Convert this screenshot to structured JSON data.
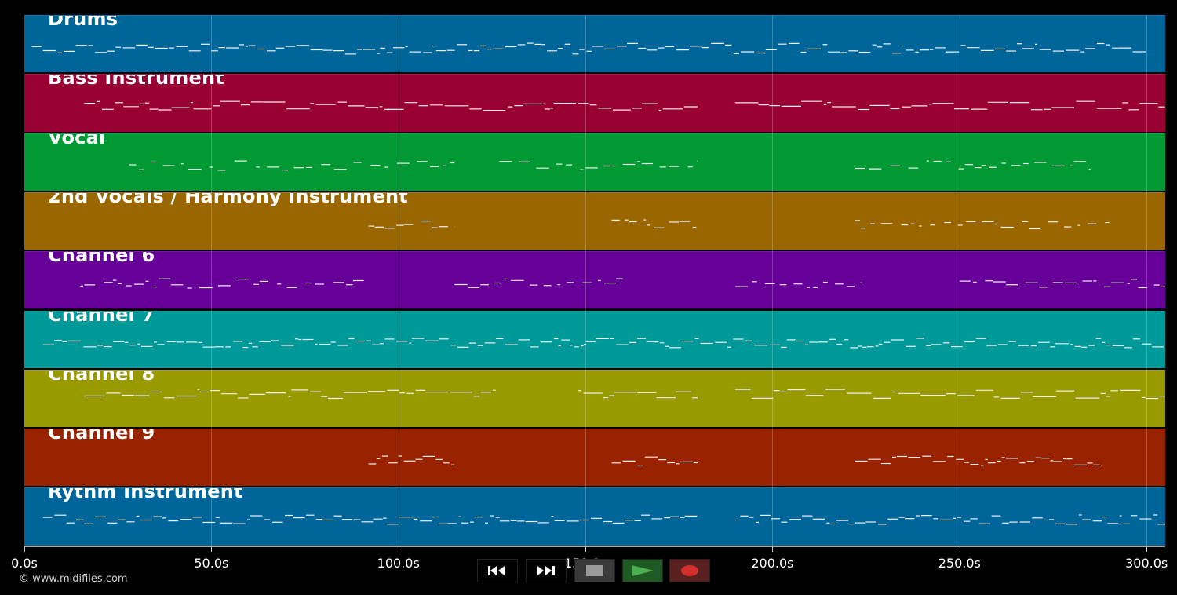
{
  "tracks": [
    {
      "name": "Drums",
      "color": "#006699"
    },
    {
      "name": "Bass Instrument",
      "color": "#990033"
    },
    {
      "name": "Vocal",
      "color": "#009933"
    },
    {
      "name": "2nd Vocals / Harmony Instrument",
      "color": "#996600"
    },
    {
      "name": "Channel 6",
      "color": "#660099"
    },
    {
      "name": "Channel 7",
      "color": "#009999"
    },
    {
      "name": "Channel 8",
      "color": "#999900"
    },
    {
      "name": "Channel 9",
      "color": "#992200"
    },
    {
      "name": "Rythm Instrument",
      "color": "#006699"
    }
  ],
  "timeline": {
    "ticks": [
      "0.0s",
      "50.0s",
      "100.0s",
      "150.0s",
      "200.0s",
      "250.0s",
      "300.0s"
    ]
  },
  "copyright": "© www.midifiles.com",
  "transport": {
    "buttons": [
      {
        "icon": "rewind-icon",
        "bg": "#111"
      },
      {
        "icon": "fast-forward-icon",
        "bg": "#111"
      },
      {
        "icon": "stop-icon",
        "bg": "#3a3a3a"
      },
      {
        "icon": "play-icon",
        "bg": "#1f5a24"
      },
      {
        "icon": "record-icon",
        "bg": "#5a1f1f"
      }
    ]
  }
}
